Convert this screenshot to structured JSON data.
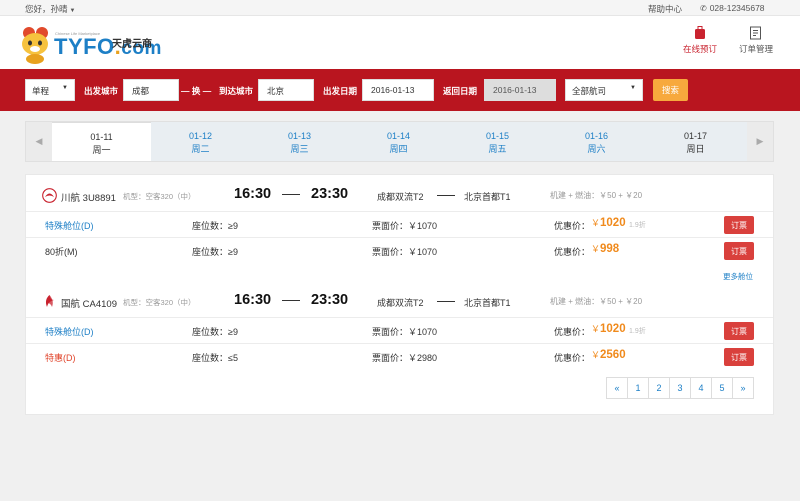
{
  "topbar": {
    "greeting": "您好，孙晴",
    "help": "帮助中心",
    "phone": "028-12345678"
  },
  "header": {
    "logo_brand": "TYFO",
    "logo_dot": ".",
    "logo_com": "com",
    "logo_cn": "天虎云商",
    "logo_tagline": "Chinese Life Marketplace",
    "nav": [
      {
        "label": "在线预订",
        "icon": "suitcase-icon"
      },
      {
        "label": "订单管理",
        "icon": "order-list-icon"
      }
    ]
  },
  "search": {
    "trip_type": "单程",
    "depart_city_label": "出发城市",
    "depart_city": "成都",
    "swap_label": "— 换 —",
    "arrive_city_label": "到达城市",
    "arrive_city": "北京",
    "depart_date_label": "出发日期",
    "depart_date": "2016-01-13",
    "return_date_label": "返回日期",
    "return_date": "2016-01-13",
    "airline": "全部航司",
    "search_button": "搜索"
  },
  "dates": [
    {
      "date": "01-11",
      "weekday": "周一"
    },
    {
      "date": "01-12",
      "weekday": "周二"
    },
    {
      "date": "01-13",
      "weekday": "周三"
    },
    {
      "date": "01-14",
      "weekday": "周四"
    },
    {
      "date": "01-15",
      "weekday": "周五"
    },
    {
      "date": "01-16",
      "weekday": "周六"
    },
    {
      "date": "01-17",
      "weekday": "周日"
    }
  ],
  "flights": [
    {
      "airline": "川航",
      "flight_no": "3U8891",
      "plane": "机型：空客320（中）",
      "dep_time": "16:30",
      "arr_time": "23:30",
      "dep_airport": "成都双流T2",
      "arr_airport": "北京首都T1",
      "taxes": "机建 + 燃油：￥50 + ￥20",
      "cabins": [
        {
          "class": "特殊舱位(D)",
          "class_color": "blue",
          "seats": "座位数：≥9",
          "fare": "票面价：￥1070",
          "disc_label": "优惠价：",
          "disc_price": "1020",
          "zhe": "1.9折",
          "book": "订票"
        },
        {
          "class": "80折(M)",
          "class_color": "gray",
          "seats": "座位数：≥9",
          "fare": "票面价：￥1070",
          "disc_label": "优惠价：",
          "disc_price": "998",
          "zhe": "",
          "book": "订票"
        }
      ],
      "more": "更多舱位"
    },
    {
      "airline": "国航",
      "flight_no": "CA4109",
      "plane": "机型：空客320（中）",
      "dep_time": "16:30",
      "arr_time": "23:30",
      "dep_airport": "成都双流T2",
      "arr_airport": "北京首都T1",
      "taxes": "机建 + 燃油：￥50 + ￥20",
      "cabins": [
        {
          "class": "特殊舱位(D)",
          "class_color": "blue",
          "seats": "座位数：≥9",
          "fare": "票面价：￥1070",
          "disc_label": "优惠价：",
          "disc_price": "1020",
          "zhe": "1.9折",
          "book": "订票"
        },
        {
          "class": "特惠(D)",
          "class_color": "red",
          "seats": "座位数：≤5",
          "fare": "票面价：￥2980",
          "disc_label": "优惠价：",
          "disc_price": "2560",
          "zhe": "",
          "book": "订票"
        }
      ]
    }
  ],
  "pagination": [
    "«",
    "1",
    "2",
    "3",
    "4",
    "5",
    "»"
  ],
  "currency": "￥",
  "colors": {
    "brand_red": "#b9151f",
    "link_blue": "#1d7fc6",
    "price_orange": "#f08a1c",
    "book_red": "#d9403c",
    "search_orange": "#f7a93d"
  }
}
